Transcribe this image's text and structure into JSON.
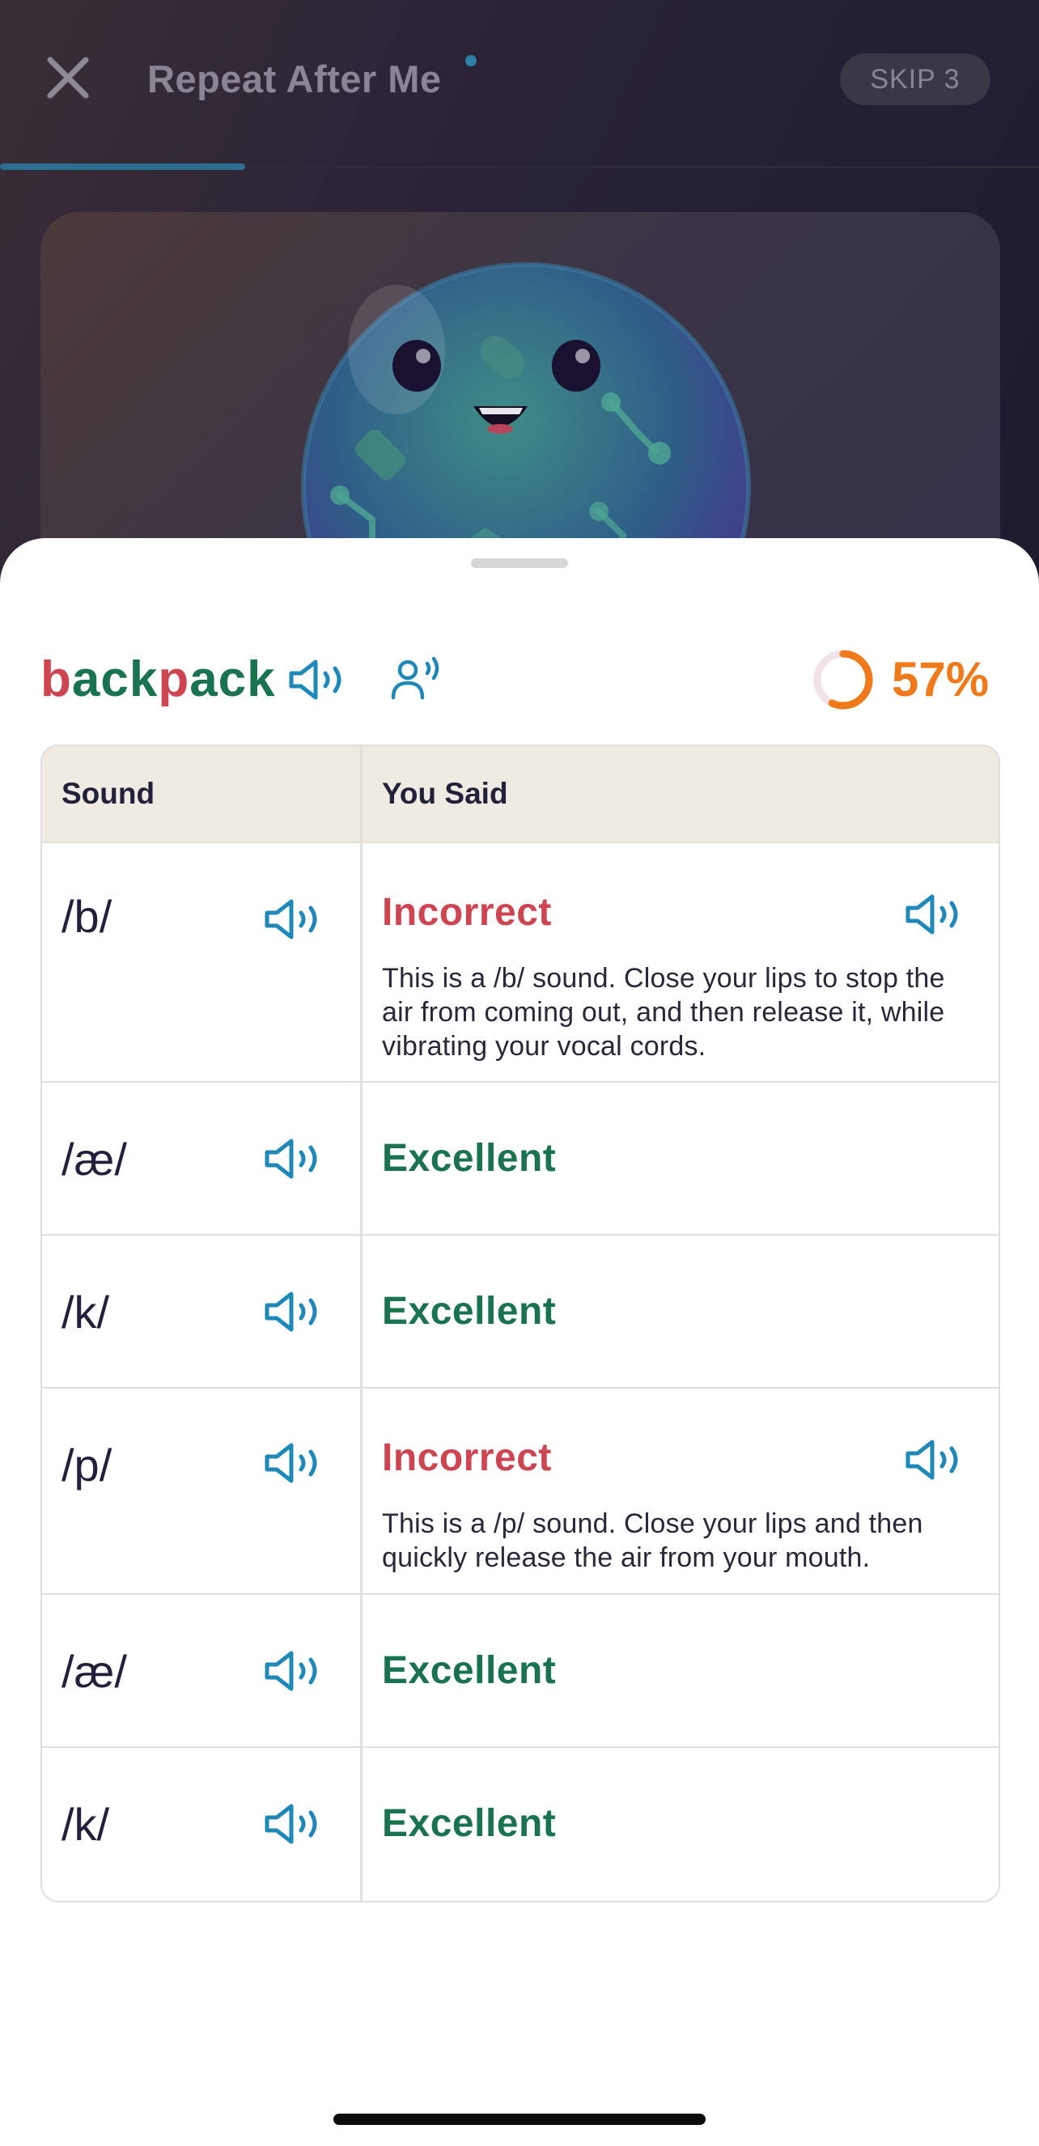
{
  "topbar": {
    "title": "Repeat After Me",
    "skip_label": "SKIP 3",
    "progress_fraction": 0.236
  },
  "word": {
    "segments": [
      {
        "text": "b",
        "status": "bad"
      },
      {
        "text": "ack",
        "status": "good"
      },
      {
        "text": "p",
        "status": "bad"
      },
      {
        "text": "ack",
        "status": "good"
      }
    ],
    "score_label": "57%",
    "score_fraction": 0.57
  },
  "table": {
    "header_sound": "Sound",
    "header_said": "You Said",
    "rows": [
      {
        "phoneme": "/b/",
        "status": "Incorrect",
        "result": "bad",
        "explanation": "This is a /b/ sound. Close your lips to stop the air from coming out, and then release it, while vibrating your vocal cords."
      },
      {
        "phoneme": "/æ/",
        "status": "Excellent",
        "result": "good"
      },
      {
        "phoneme": "/k/",
        "status": "Excellent",
        "result": "good"
      },
      {
        "phoneme": "/p/",
        "status": "Incorrect",
        "result": "bad",
        "explanation": "This is a /p/ sound. Close your lips and then quickly release the air from your mouth."
      },
      {
        "phoneme": "/æ/",
        "status": "Excellent",
        "result": "good"
      },
      {
        "phoneme": "/k/",
        "status": "Excellent",
        "result": "good"
      }
    ]
  },
  "colors": {
    "incorrect": "#cf4451",
    "correct": "#19734f",
    "accent_blue": "#1e88b8",
    "score_orange": "#f07a1a"
  }
}
